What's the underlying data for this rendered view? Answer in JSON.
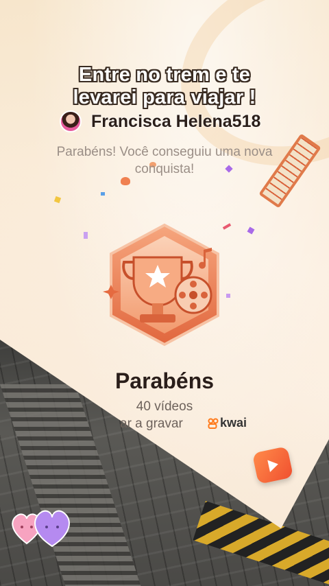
{
  "overlay": {
    "title_line1": "Entre no trem e te",
    "title_line2": "levarei para viajar !",
    "username": "Francisca Helena518"
  },
  "achievement": {
    "message": "Parabéns! Você conseguiu uma nova conquista!",
    "heading": "Parabéns",
    "videos_count": "40 vídeos",
    "cta_partial": "ar a gravar",
    "brand": "kwai"
  },
  "colors": {
    "badge_orange": "#f08a5d",
    "badge_dark": "#d9633b",
    "card_bg": "#fbeede"
  },
  "icons": [
    "avatar",
    "trophy-badge-icon",
    "kwai-logo-icon",
    "play-button-icon",
    "heart-stickers"
  ]
}
